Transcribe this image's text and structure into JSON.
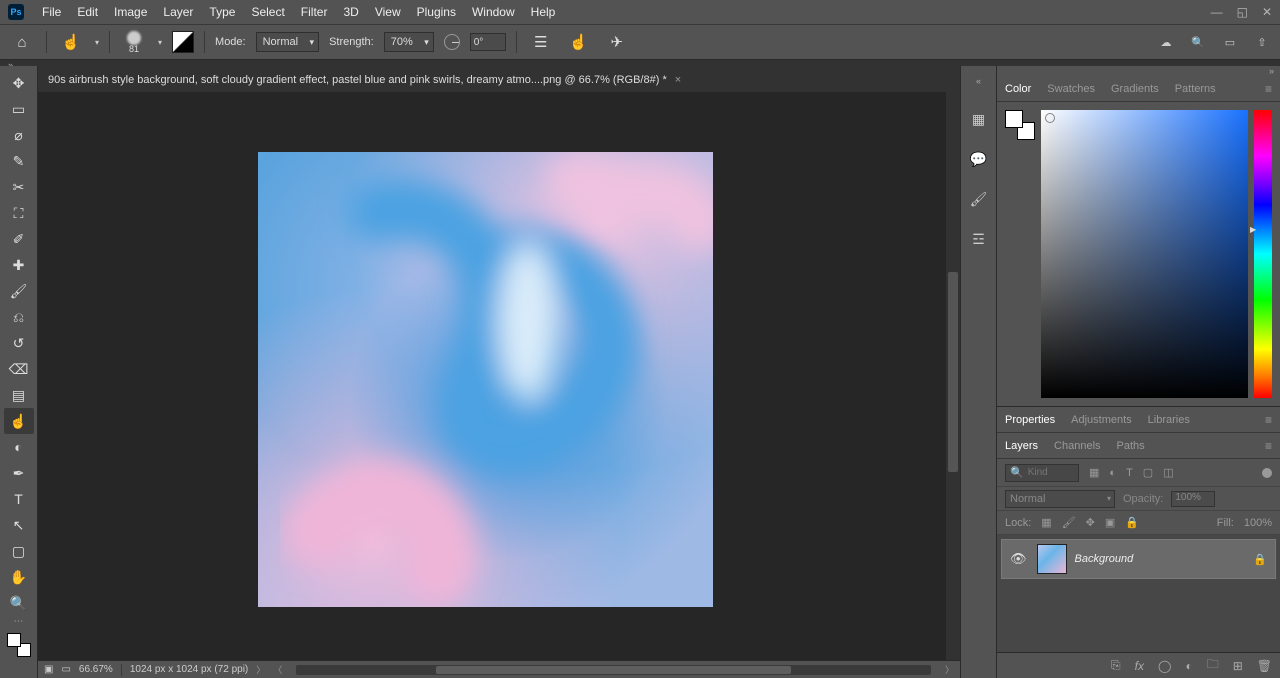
{
  "menu": {
    "items": [
      "File",
      "Edit",
      "Image",
      "Layer",
      "Type",
      "Select",
      "Filter",
      "3D",
      "View",
      "Plugins",
      "Window",
      "Help"
    ]
  },
  "logo": "Ps",
  "optbar": {
    "brush_size": "81",
    "mode_label": "Mode:",
    "mode_value": "Normal",
    "strength_label": "Strength:",
    "strength_value": "70%",
    "angle_value": "0°"
  },
  "doc": {
    "title": "90s airbrush style background, soft cloudy gradient effect, pastel blue and pink swirls, dreamy atmo....png @ 66.7% (RGB/8#) *"
  },
  "status": {
    "zoom": "66.67%",
    "dims": "1024 px x 1024 px (72 ppi)"
  },
  "panels": {
    "color_tabs": [
      "Color",
      "Swatches",
      "Gradients",
      "Patterns"
    ],
    "props_tabs": [
      "Properties",
      "Adjustments",
      "Libraries"
    ],
    "layers_tabs": [
      "Layers",
      "Channels",
      "Paths"
    ]
  },
  "layers": {
    "kind_placeholder": "Kind",
    "blend": "Normal",
    "opacity_label": "Opacity:",
    "opacity_value": "100%",
    "lock_label": "Lock:",
    "fill_label": "Fill:",
    "fill_value": "100%",
    "items": [
      {
        "name": "Background",
        "locked": true
      }
    ]
  },
  "tools": [
    {
      "id": "move",
      "g": "✥"
    },
    {
      "id": "marquee",
      "g": "▭"
    },
    {
      "id": "lasso",
      "g": "⌀"
    },
    {
      "id": "quick-select",
      "g": "✎"
    },
    {
      "id": "crop",
      "g": "✂"
    },
    {
      "id": "frame",
      "g": "⛶"
    },
    {
      "id": "eyedropper",
      "g": "✐"
    },
    {
      "id": "healing",
      "g": "✚"
    },
    {
      "id": "brush",
      "g": "🖌"
    },
    {
      "id": "stamp",
      "g": "⎌"
    },
    {
      "id": "history",
      "g": "↺"
    },
    {
      "id": "eraser",
      "g": "⌫"
    },
    {
      "id": "gradient",
      "g": "▤"
    },
    {
      "id": "smudge",
      "g": "☝"
    },
    {
      "id": "dodge",
      "g": "◐"
    },
    {
      "id": "pen",
      "g": "✒"
    },
    {
      "id": "type",
      "g": "T"
    },
    {
      "id": "path-select",
      "g": "↖"
    },
    {
      "id": "rect",
      "g": "▢"
    },
    {
      "id": "hand",
      "g": "✋"
    },
    {
      "id": "zoom",
      "g": "🔍"
    }
  ]
}
